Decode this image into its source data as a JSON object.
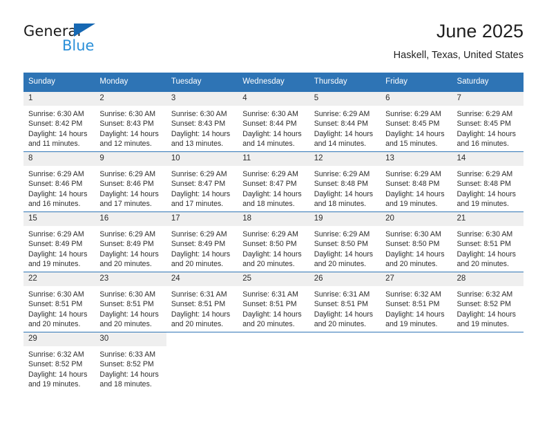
{
  "logo": {
    "primary_text": "General",
    "secondary_text": "Blue",
    "triangle_icon": "triangle-icon",
    "primary_color": "#1c1c1c",
    "secondary_color": "#2a8fd8",
    "triangle_color": "#1668b3"
  },
  "header": {
    "title": "June 2025",
    "location": "Haskell, Texas, United States"
  },
  "theme": {
    "header_bg": "#2e74b5",
    "header_text": "#ffffff",
    "daynum_bg": "#efefef",
    "row_border": "#2e74b5",
    "body_text": "#2b2b2b"
  },
  "weekday_headers": [
    "Sunday",
    "Monday",
    "Tuesday",
    "Wednesday",
    "Thursday",
    "Friday",
    "Saturday"
  ],
  "weeks": [
    [
      {
        "day": "1",
        "sunrise": "Sunrise: 6:30 AM",
        "sunset": "Sunset: 8:42 PM",
        "daylight": "Daylight: 14 hours and 11 minutes."
      },
      {
        "day": "2",
        "sunrise": "Sunrise: 6:30 AM",
        "sunset": "Sunset: 8:43 PM",
        "daylight": "Daylight: 14 hours and 12 minutes."
      },
      {
        "day": "3",
        "sunrise": "Sunrise: 6:30 AM",
        "sunset": "Sunset: 8:43 PM",
        "daylight": "Daylight: 14 hours and 13 minutes."
      },
      {
        "day": "4",
        "sunrise": "Sunrise: 6:30 AM",
        "sunset": "Sunset: 8:44 PM",
        "daylight": "Daylight: 14 hours and 14 minutes."
      },
      {
        "day": "5",
        "sunrise": "Sunrise: 6:29 AM",
        "sunset": "Sunset: 8:44 PM",
        "daylight": "Daylight: 14 hours and 14 minutes."
      },
      {
        "day": "6",
        "sunrise": "Sunrise: 6:29 AM",
        "sunset": "Sunset: 8:45 PM",
        "daylight": "Daylight: 14 hours and 15 minutes."
      },
      {
        "day": "7",
        "sunrise": "Sunrise: 6:29 AM",
        "sunset": "Sunset: 8:45 PM",
        "daylight": "Daylight: 14 hours and 16 minutes."
      }
    ],
    [
      {
        "day": "8",
        "sunrise": "Sunrise: 6:29 AM",
        "sunset": "Sunset: 8:46 PM",
        "daylight": "Daylight: 14 hours and 16 minutes."
      },
      {
        "day": "9",
        "sunrise": "Sunrise: 6:29 AM",
        "sunset": "Sunset: 8:46 PM",
        "daylight": "Daylight: 14 hours and 17 minutes."
      },
      {
        "day": "10",
        "sunrise": "Sunrise: 6:29 AM",
        "sunset": "Sunset: 8:47 PM",
        "daylight": "Daylight: 14 hours and 17 minutes."
      },
      {
        "day": "11",
        "sunrise": "Sunrise: 6:29 AM",
        "sunset": "Sunset: 8:47 PM",
        "daylight": "Daylight: 14 hours and 18 minutes."
      },
      {
        "day": "12",
        "sunrise": "Sunrise: 6:29 AM",
        "sunset": "Sunset: 8:48 PM",
        "daylight": "Daylight: 14 hours and 18 minutes."
      },
      {
        "day": "13",
        "sunrise": "Sunrise: 6:29 AM",
        "sunset": "Sunset: 8:48 PM",
        "daylight": "Daylight: 14 hours and 19 minutes."
      },
      {
        "day": "14",
        "sunrise": "Sunrise: 6:29 AM",
        "sunset": "Sunset: 8:48 PM",
        "daylight": "Daylight: 14 hours and 19 minutes."
      }
    ],
    [
      {
        "day": "15",
        "sunrise": "Sunrise: 6:29 AM",
        "sunset": "Sunset: 8:49 PM",
        "daylight": "Daylight: 14 hours and 19 minutes."
      },
      {
        "day": "16",
        "sunrise": "Sunrise: 6:29 AM",
        "sunset": "Sunset: 8:49 PM",
        "daylight": "Daylight: 14 hours and 20 minutes."
      },
      {
        "day": "17",
        "sunrise": "Sunrise: 6:29 AM",
        "sunset": "Sunset: 8:49 PM",
        "daylight": "Daylight: 14 hours and 20 minutes."
      },
      {
        "day": "18",
        "sunrise": "Sunrise: 6:29 AM",
        "sunset": "Sunset: 8:50 PM",
        "daylight": "Daylight: 14 hours and 20 minutes."
      },
      {
        "day": "19",
        "sunrise": "Sunrise: 6:29 AM",
        "sunset": "Sunset: 8:50 PM",
        "daylight": "Daylight: 14 hours and 20 minutes."
      },
      {
        "day": "20",
        "sunrise": "Sunrise: 6:30 AM",
        "sunset": "Sunset: 8:50 PM",
        "daylight": "Daylight: 14 hours and 20 minutes."
      },
      {
        "day": "21",
        "sunrise": "Sunrise: 6:30 AM",
        "sunset": "Sunset: 8:51 PM",
        "daylight": "Daylight: 14 hours and 20 minutes."
      }
    ],
    [
      {
        "day": "22",
        "sunrise": "Sunrise: 6:30 AM",
        "sunset": "Sunset: 8:51 PM",
        "daylight": "Daylight: 14 hours and 20 minutes."
      },
      {
        "day": "23",
        "sunrise": "Sunrise: 6:30 AM",
        "sunset": "Sunset: 8:51 PM",
        "daylight": "Daylight: 14 hours and 20 minutes."
      },
      {
        "day": "24",
        "sunrise": "Sunrise: 6:31 AM",
        "sunset": "Sunset: 8:51 PM",
        "daylight": "Daylight: 14 hours and 20 minutes."
      },
      {
        "day": "25",
        "sunrise": "Sunrise: 6:31 AM",
        "sunset": "Sunset: 8:51 PM",
        "daylight": "Daylight: 14 hours and 20 minutes."
      },
      {
        "day": "26",
        "sunrise": "Sunrise: 6:31 AM",
        "sunset": "Sunset: 8:51 PM",
        "daylight": "Daylight: 14 hours and 20 minutes."
      },
      {
        "day": "27",
        "sunrise": "Sunrise: 6:32 AM",
        "sunset": "Sunset: 8:51 PM",
        "daylight": "Daylight: 14 hours and 19 minutes."
      },
      {
        "day": "28",
        "sunrise": "Sunrise: 6:32 AM",
        "sunset": "Sunset: 8:52 PM",
        "daylight": "Daylight: 14 hours and 19 minutes."
      }
    ],
    [
      {
        "day": "29",
        "sunrise": "Sunrise: 6:32 AM",
        "sunset": "Sunset: 8:52 PM",
        "daylight": "Daylight: 14 hours and 19 minutes."
      },
      {
        "day": "30",
        "sunrise": "Sunrise: 6:33 AM",
        "sunset": "Sunset: 8:52 PM",
        "daylight": "Daylight: 14 hours and 18 minutes."
      },
      {
        "day": "",
        "sunrise": "",
        "sunset": "",
        "daylight": ""
      },
      {
        "day": "",
        "sunrise": "",
        "sunset": "",
        "daylight": ""
      },
      {
        "day": "",
        "sunrise": "",
        "sunset": "",
        "daylight": ""
      },
      {
        "day": "",
        "sunrise": "",
        "sunset": "",
        "daylight": ""
      },
      {
        "day": "",
        "sunrise": "",
        "sunset": "",
        "daylight": ""
      }
    ]
  ]
}
